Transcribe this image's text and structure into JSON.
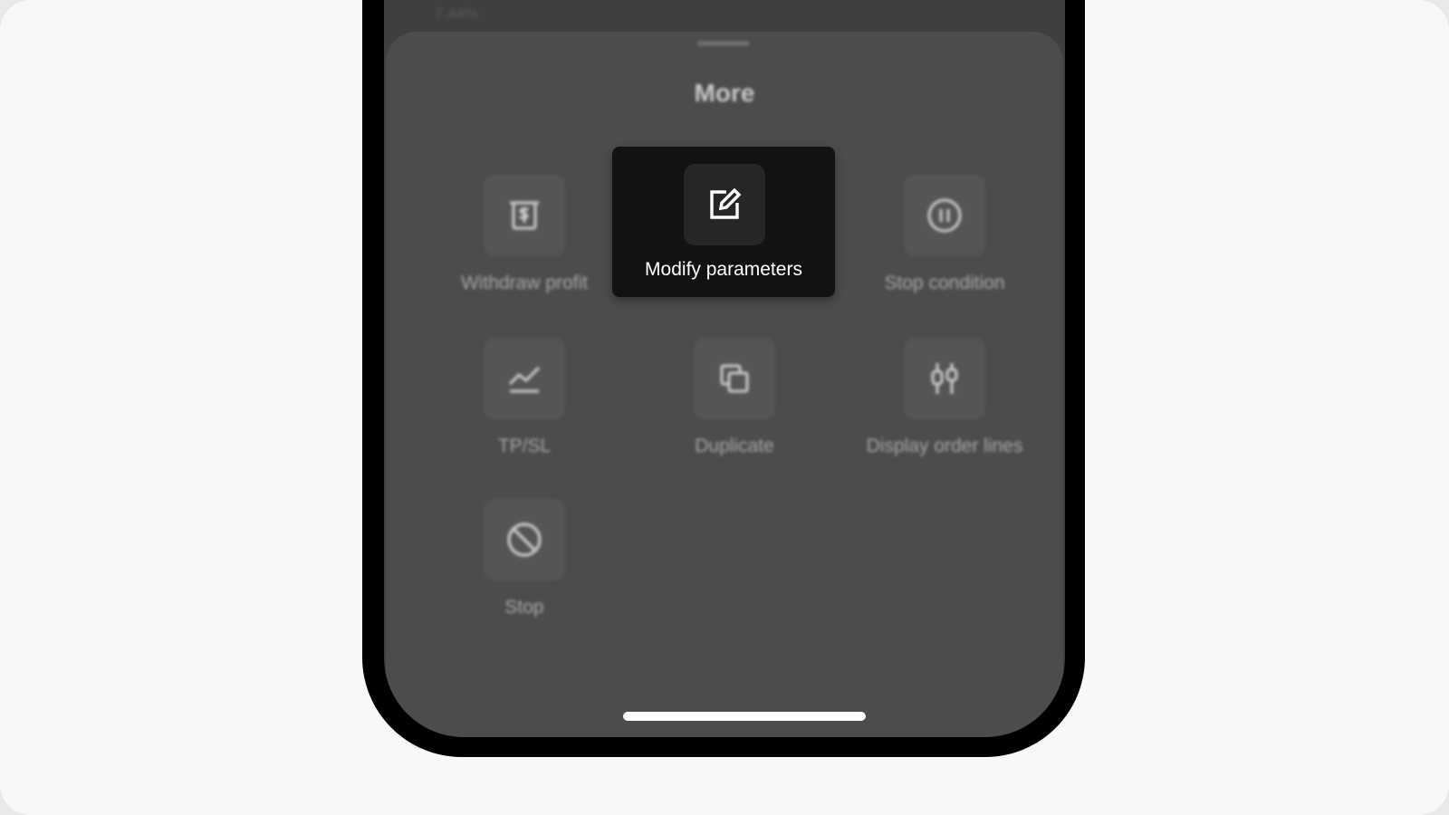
{
  "background_text": "7.44%",
  "sheet": {
    "title": "More",
    "actions": [
      {
        "label": "Withdraw profit",
        "icon": "withdraw-icon"
      },
      {
        "label": "Modify parameters",
        "icon": "edit-icon"
      },
      {
        "label": "Stop condition",
        "icon": "pause-circle-icon"
      },
      {
        "label": "TP/SL",
        "icon": "line-chart-icon"
      },
      {
        "label": "Duplicate",
        "icon": "duplicate-icon"
      },
      {
        "label": "Display order lines",
        "icon": "candlestick-icon"
      },
      {
        "label": "Stop",
        "icon": "stop-icon"
      }
    ]
  },
  "colors": {
    "sheet_background": "#4c4c4c",
    "highlight_background": "#121212",
    "highlight_text": "#ffffff"
  }
}
